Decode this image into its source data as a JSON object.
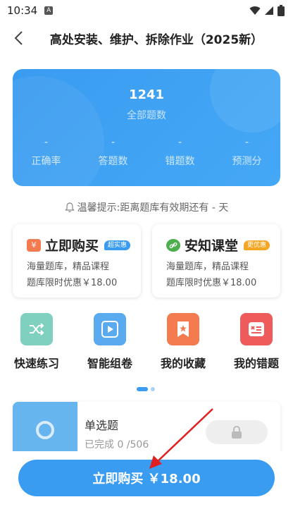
{
  "status_bar": {
    "time": "10:34"
  },
  "nav": {
    "title": "高处安装、维护、拆除作业（2025新）"
  },
  "stats": {
    "total": "1241",
    "total_label": "全部题数",
    "items": [
      {
        "value": "-",
        "label": "正确率"
      },
      {
        "value": "-",
        "label": "答题数"
      },
      {
        "value": "-",
        "label": "错题数"
      },
      {
        "value": "-",
        "label": "预测分"
      }
    ]
  },
  "tip": {
    "text": "温馨提示:距离题库有效期还有 - 天"
  },
  "promos": [
    {
      "icon": "yen-icon",
      "icon_text": "¥",
      "title": "立即购买",
      "badge": "超实惠",
      "line1": "海量题库，精品课程",
      "line2": "题库限时优惠￥18.00",
      "color": "#f47a4f",
      "badge_color": "#3a9cf0"
    },
    {
      "icon": "link-icon",
      "title": "安知课堂",
      "badge": "更优惠",
      "line1": "海量题库，精品课程",
      "line2": "题库限时优惠￥18.00",
      "color": "#4cae4c",
      "badge_color": "#f5a623"
    }
  ],
  "features": [
    {
      "label": "快速练习",
      "icon": "shuffle-icon",
      "color": "#7fd0bf"
    },
    {
      "label": "智能组卷",
      "icon": "play-icon",
      "color": "#5aaaf0"
    },
    {
      "label": "我的收藏",
      "icon": "bookmark-star-icon",
      "color": "#f47a4f"
    },
    {
      "label": "我的错题",
      "icon": "wrong-questions-icon",
      "color": "#ef5a5a"
    }
  ],
  "question_type": {
    "title": "单选题",
    "progress": "已完成 0 /506"
  },
  "buy_button": {
    "label": "立即购买 ￥18.00"
  },
  "colors": {
    "accent": "#3a9cf0",
    "annotation_arrow": "#e02020"
  }
}
